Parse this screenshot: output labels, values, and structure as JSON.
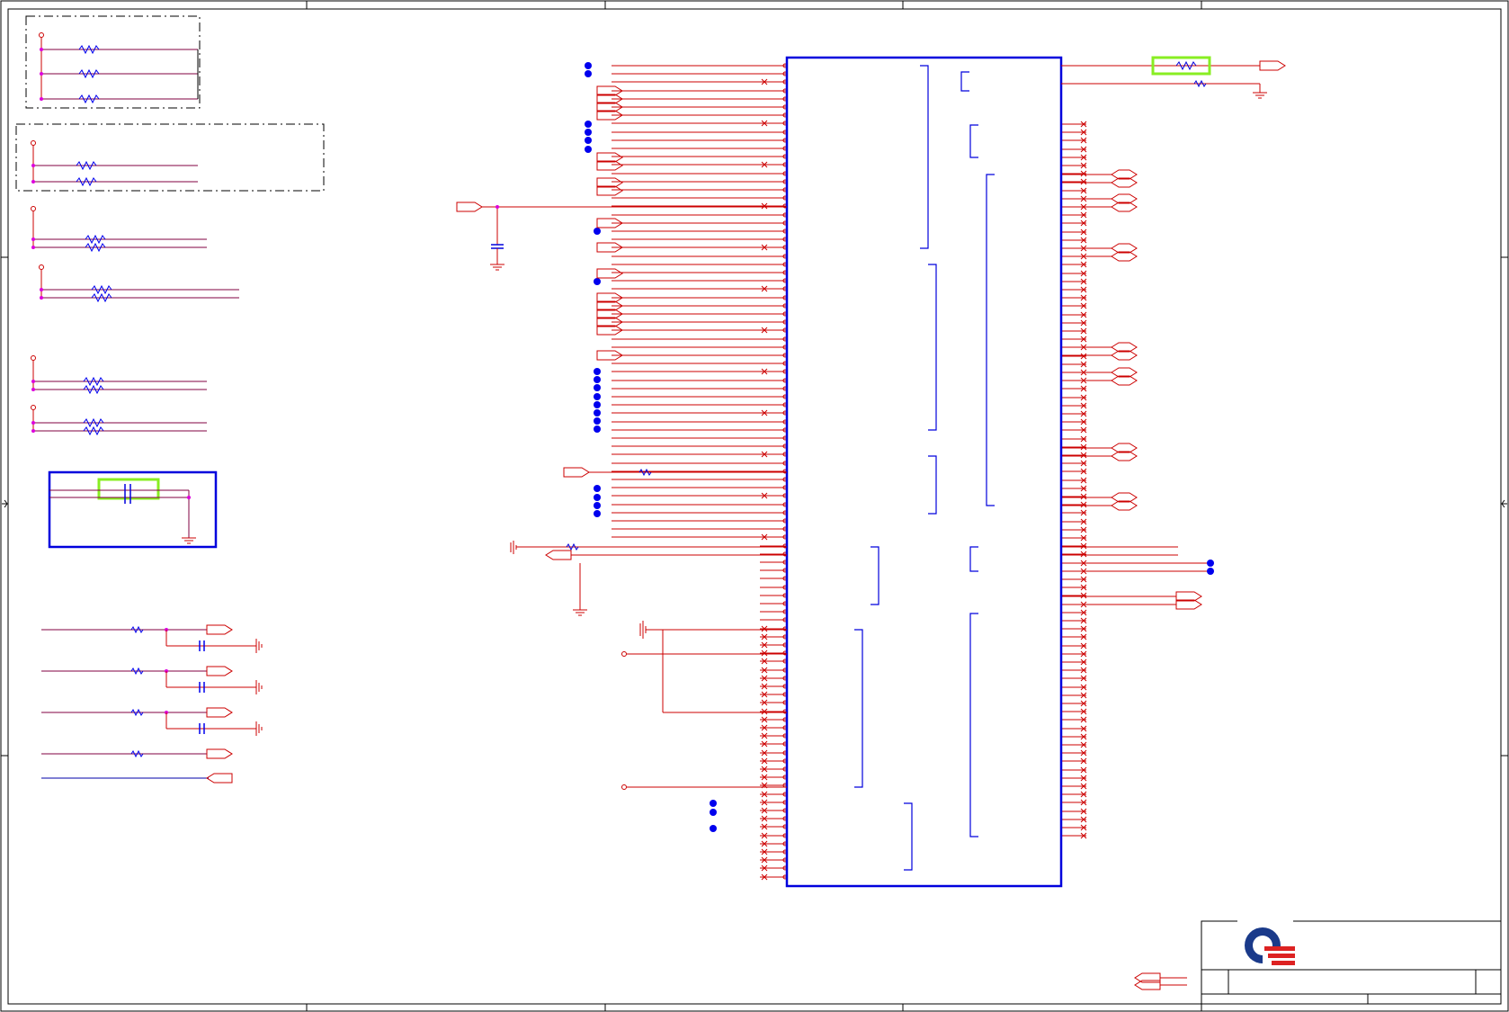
{
  "sheet": {
    "background": "#ffffff",
    "colors": {
      "wire": "#cc0000",
      "net": "#800040",
      "border": "#0000dd",
      "junction": "#0000ee",
      "pin": "#dd00dd",
      "highlight": "#88ee22",
      "frame": "#000000"
    }
  },
  "logo": {
    "icon": "quanta-logo-icon",
    "colors": [
      "#1a3a8a",
      "#dd2222"
    ]
  },
  "title_block": {
    "title": "",
    "doc_number": "",
    "rev": ""
  }
}
